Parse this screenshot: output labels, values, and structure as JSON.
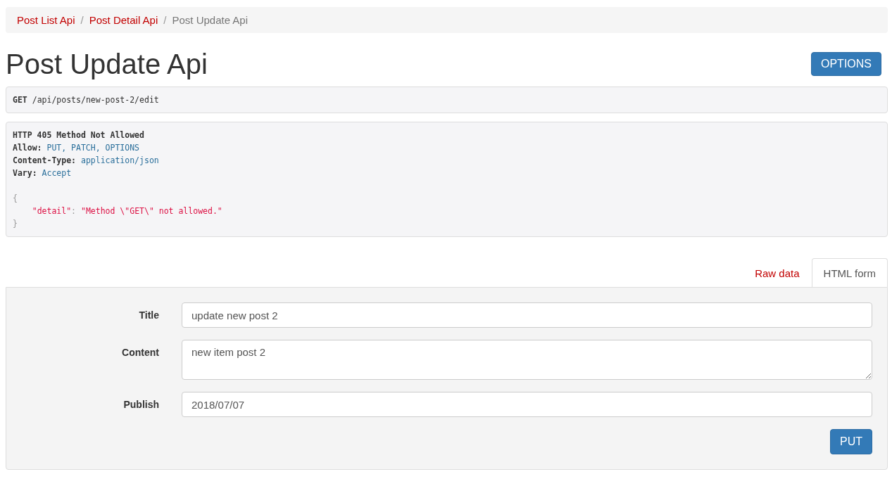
{
  "breadcrumb": [
    {
      "label": "Post List Api",
      "selected": false
    },
    {
      "separator": "/",
      "label": "Post Detail Api",
      "selected": false
    },
    {
      "separator": "/",
      "label": "Post Update Api",
      "selected": true
    }
  ],
  "title": "Post Update Api",
  "options_button": "OPTIONS",
  "request": {
    "method": "GET",
    "path": "/api/posts/new-post-2/edit"
  },
  "response": {
    "status": "HTTP 405 Method Not Allowed",
    "headers": [
      {
        "name": "Allow:",
        "value": "PUT, PATCH, OPTIONS"
      },
      {
        "name": "Content-Type:",
        "value": "application/json"
      },
      {
        "name": "Vary:",
        "value": "Accept"
      }
    ],
    "body": [
      {
        "kind": "punct",
        "text": "{"
      },
      {
        "kind": "pair",
        "key": "\"detail\"",
        "colon": ":",
        "value": "\"Method \\\"GET\\\" not allowed.\""
      },
      {
        "kind": "punct",
        "text": "}"
      }
    ]
  },
  "tabs": [
    {
      "label": "Raw data",
      "selected": false
    },
    {
      "label": "HTML form",
      "selected": true
    }
  ],
  "form": {
    "fields": [
      {
        "kind": "text",
        "label": "Title",
        "value": "update new post 2"
      },
      {
        "kind": "textarea",
        "label": "Content",
        "value": "new item post 2"
      },
      {
        "kind": "text",
        "label": "Publish",
        "value": "2018/07/07"
      }
    ],
    "submit": "PUT"
  }
}
